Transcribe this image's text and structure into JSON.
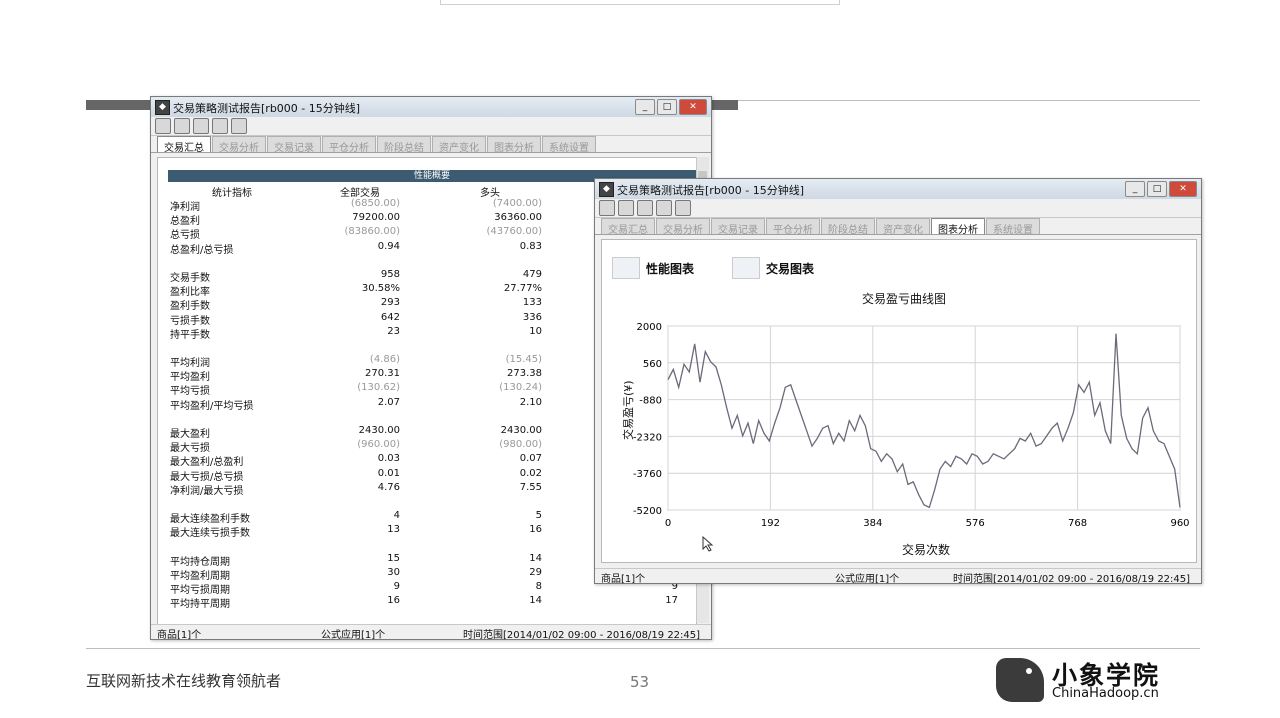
{
  "window1": {
    "title": "交易策略测试报告[rb000 - 15分钟线]",
    "tabs": [
      "交易汇总",
      "交易分析",
      "交易记录",
      "平仓分析",
      "阶段总结",
      "资产变化",
      "图表分析",
      "系统设置"
    ],
    "active_tab": 0,
    "section_title": "性能概要",
    "columns": [
      "统计指标",
      "全部交易",
      "多头"
    ],
    "rows": [
      {
        "label": "净利润",
        "all": "(6850.00)",
        "long": "(7400.00)",
        "gray": true
      },
      {
        "label": "总盈利",
        "all": "79200.00",
        "long": "36360.00"
      },
      {
        "label": "总亏损",
        "all": "(83860.00)",
        "long": "(43760.00)",
        "gray": true
      },
      {
        "label": "总盈利/总亏损",
        "all": "0.94",
        "long": "0.83"
      },
      null,
      {
        "label": "交易手数",
        "all": "958",
        "long": "479"
      },
      {
        "label": "盈利比率",
        "all": "30.58%",
        "long": "27.77%"
      },
      {
        "label": "盈利手数",
        "all": "293",
        "long": "133"
      },
      {
        "label": "亏损手数",
        "all": "642",
        "long": "336"
      },
      {
        "label": "持平手数",
        "all": "23",
        "long": "10"
      },
      null,
      {
        "label": "平均利润",
        "all": "(4.86)",
        "long": "(15.45)",
        "gray": true
      },
      {
        "label": "平均盈利",
        "all": "270.31",
        "long": "273.38"
      },
      {
        "label": "平均亏损",
        "all": "(130.62)",
        "long": "(130.24)",
        "gray": true
      },
      {
        "label": "平均盈利/平均亏损",
        "all": "2.07",
        "long": "2.10"
      },
      null,
      {
        "label": "最大盈利",
        "all": "2430.00",
        "long": "2430.00"
      },
      {
        "label": "最大亏损",
        "all": "(960.00)",
        "long": "(980.00)",
        "gray": true
      },
      {
        "label": "最大盈利/总盈利",
        "all": "0.03",
        "long": "0.07"
      },
      {
        "label": "最大亏损/总亏损",
        "all": "0.01",
        "long": "0.02"
      },
      {
        "label": "净利润/最大亏损",
        "all": "4.76",
        "long": "7.55"
      },
      null,
      {
        "label": "最大连续盈利手数",
        "all": "4",
        "long": "5"
      },
      {
        "label": "最大连续亏损手数",
        "all": "13",
        "long": "16"
      },
      null,
      {
        "label": "平均持仓周期",
        "all": "15",
        "long": "14"
      },
      {
        "label": "平均盈利周期",
        "all": "30",
        "long": "29"
      },
      {
        "label": "平均亏损周期",
        "all": "9",
        "long": "8",
        "short": "9"
      },
      {
        "label": "平均持平周期",
        "all": "16",
        "long": "14",
        "short": "17"
      }
    ],
    "status": {
      "goods": "商品[1]个",
      "formula": "公式应用[1]个",
      "range": "时间范围[2014/01/02 09:00 - 2016/08/19 22:45]"
    }
  },
  "window2": {
    "title": "交易策略测试报告[rb000 - 15分钟线]",
    "tabs": [
      "交易汇总",
      "交易分析",
      "交易记录",
      "平仓分析",
      "阶段总结",
      "资产变化",
      "图表分析",
      "系统设置"
    ],
    "active_tab": 6,
    "buttons": {
      "performance": "性能图表",
      "trade": "交易图表"
    },
    "status": {
      "goods": "商品[1]个",
      "formula": "公式应用[1]个",
      "range": "时间范围[2014/01/02 09:00 - 2016/08/19 22:45]"
    }
  },
  "chart_data": {
    "type": "line",
    "title": "交易盈亏曲线图",
    "xlabel": "交易次数",
    "ylabel": "交易盈亏(¥)",
    "xlim": [
      0,
      960
    ],
    "ylim": [
      -5200,
      2000
    ],
    "xticks": [
      0,
      192,
      384,
      576,
      768,
      960
    ],
    "yticks": [
      2000,
      560,
      -880,
      -2320,
      -3760,
      -5200
    ],
    "grid": true,
    "series": [
      {
        "x": [
          0,
          10,
          20,
          30,
          40,
          50,
          60,
          70,
          80,
          90,
          100,
          110,
          120,
          130,
          140,
          150,
          160,
          170,
          180,
          190,
          200,
          210,
          220,
          230,
          240,
          250,
          260,
          270,
          280,
          290,
          300,
          310,
          320,
          330,
          340,
          350,
          360,
          370,
          380,
          390,
          400,
          410,
          420,
          430,
          440,
          450,
          460,
          470,
          480,
          490,
          500,
          510,
          520,
          530,
          540,
          550,
          560,
          570,
          580,
          590,
          600,
          610,
          620,
          630,
          640,
          650,
          660,
          670,
          680,
          690,
          700,
          710,
          720,
          730,
          740,
          750,
          760,
          770,
          780,
          790,
          800,
          810,
          820,
          830,
          840,
          850,
          860,
          870,
          880,
          890,
          900,
          910,
          920,
          930,
          940,
          950,
          960
        ],
        "y": [
          -100,
          300,
          -400,
          500,
          200,
          1300,
          -200,
          1000,
          600,
          400,
          -300,
          -1200,
          -2000,
          -1500,
          -2300,
          -1800,
          -2600,
          -1700,
          -2200,
          -2500,
          -1800,
          -1200,
          -400,
          -300,
          -900,
          -1500,
          -2100,
          -2700,
          -2400,
          -2000,
          -1900,
          -2600,
          -2200,
          -2500,
          -1700,
          -2100,
          -1500,
          -1900,
          -2800,
          -2900,
          -3300,
          -3000,
          -3200,
          -3700,
          -3400,
          -4200,
          -4100,
          -4600,
          -5000,
          -5100,
          -4400,
          -3600,
          -3300,
          -3500,
          -3100,
          -3200,
          -3400,
          -3000,
          -3100,
          -3400,
          -3300,
          -3000,
          -3100,
          -3200,
          -3000,
          -2800,
          -2400,
          -2500,
          -2200,
          -2700,
          -2600,
          -2300,
          -2000,
          -1800,
          -2500,
          -2000,
          -1400,
          -300,
          -600,
          -200,
          -1500,
          -1000,
          -2100,
          -2600,
          1700,
          -1500,
          -2400,
          -2800,
          -3000,
          -1600,
          -1200,
          -2100,
          -2500,
          -2600,
          -3100,
          -3600,
          -5100
        ]
      }
    ]
  }
}
